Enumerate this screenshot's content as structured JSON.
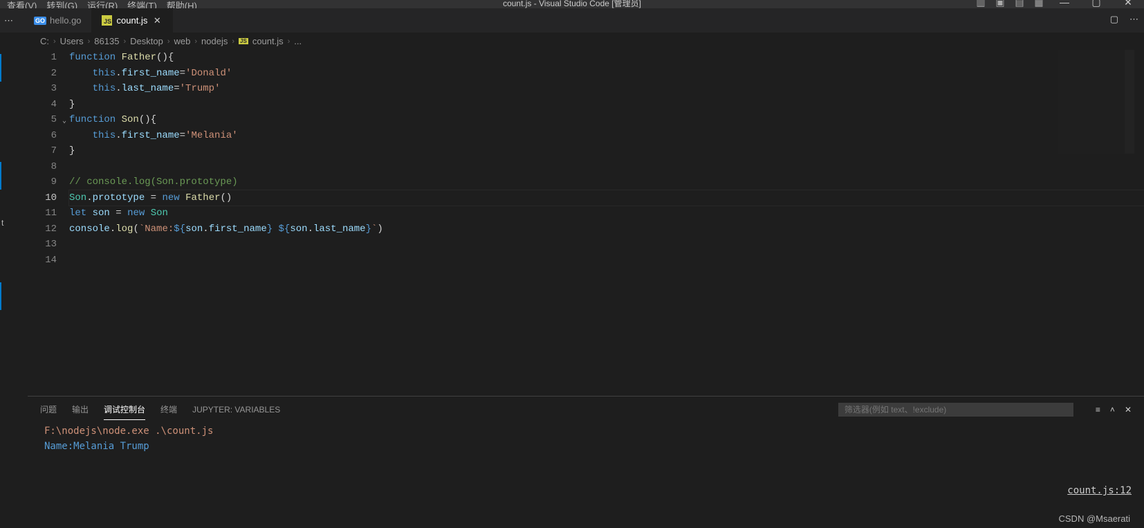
{
  "menubar": {
    "view": "查看(V)",
    "goto": "转到(G)",
    "run": "运行(R)",
    "terminal": "终端(T)",
    "help": "帮助(H)"
  },
  "window_title": "count.js - Visual Studio Code [管理员]",
  "tabs": [
    {
      "icon": "GO",
      "label": "hello.go",
      "active": false
    },
    {
      "icon": "JS",
      "label": "count.js",
      "active": true
    }
  ],
  "tab_overflow": "⋯",
  "editor_actions": {
    "split": "▢",
    "more": "⋯"
  },
  "breadcrumbs": [
    "C:",
    "Users",
    "86135",
    "Desktop",
    "web",
    "nodejs",
    "count.js",
    "..."
  ],
  "current_line": 10,
  "code": {
    "lines": [
      {
        "n": 1,
        "seg": [
          [
            "kw",
            "function"
          ],
          [
            "punc",
            " "
          ],
          [
            "fn",
            "Father"
          ],
          [
            "punc",
            "(){"
          ]
        ]
      },
      {
        "n": 2,
        "seg": [
          [
            "punc",
            "    "
          ],
          [
            "this",
            "this"
          ],
          [
            "punc",
            "."
          ],
          [
            "prop",
            "first_name"
          ],
          [
            "punc",
            "="
          ],
          [
            "str",
            "'Donald'"
          ]
        ]
      },
      {
        "n": 3,
        "seg": [
          [
            "punc",
            "    "
          ],
          [
            "this",
            "this"
          ],
          [
            "punc",
            "."
          ],
          [
            "prop",
            "last_name"
          ],
          [
            "punc",
            "="
          ],
          [
            "str",
            "'Trump'"
          ]
        ]
      },
      {
        "n": 4,
        "seg": [
          [
            "punc",
            "}"
          ]
        ]
      },
      {
        "n": 5,
        "fold": true,
        "seg": [
          [
            "kw",
            "function"
          ],
          [
            "punc",
            " "
          ],
          [
            "fn",
            "Son"
          ],
          [
            "punc",
            "(){"
          ]
        ]
      },
      {
        "n": 6,
        "seg": [
          [
            "punc",
            "    "
          ],
          [
            "this",
            "this"
          ],
          [
            "punc",
            "."
          ],
          [
            "prop",
            "first_name"
          ],
          [
            "punc",
            "="
          ],
          [
            "str",
            "'Melania'"
          ]
        ]
      },
      {
        "n": 7,
        "seg": [
          [
            "punc",
            "}"
          ]
        ]
      },
      {
        "n": 8,
        "seg": []
      },
      {
        "n": 9,
        "seg": [
          [
            "comment",
            "// console.log(Son.prototype)"
          ]
        ]
      },
      {
        "n": 10,
        "seg": [
          [
            "class",
            "Son"
          ],
          [
            "punc",
            "."
          ],
          [
            "prop",
            "prototype"
          ],
          [
            "punc",
            " = "
          ],
          [
            "kw",
            "new"
          ],
          [
            "punc",
            " "
          ],
          [
            "fn",
            "Father"
          ],
          [
            "punc",
            "()"
          ]
        ]
      },
      {
        "n": 11,
        "seg": [
          [
            "kw",
            "let"
          ],
          [
            "punc",
            " "
          ],
          [
            "var",
            "son"
          ],
          [
            "punc",
            " = "
          ],
          [
            "kw",
            "new"
          ],
          [
            "punc",
            " "
          ],
          [
            "class",
            "Son"
          ]
        ]
      },
      {
        "n": 12,
        "seg": [
          [
            "var",
            "console"
          ],
          [
            "punc",
            "."
          ],
          [
            "fn",
            "log"
          ],
          [
            "punc",
            "("
          ],
          [
            "tmpl",
            "`Name:"
          ],
          [
            "kw",
            "${"
          ],
          [
            "var",
            "son"
          ],
          [
            "punc",
            "."
          ],
          [
            "prop",
            "first_name"
          ],
          [
            "kw",
            "}"
          ],
          [
            "tmpl",
            " "
          ],
          [
            "kw",
            "${"
          ],
          [
            "var",
            "son"
          ],
          [
            "punc",
            "."
          ],
          [
            "prop",
            "last_name"
          ],
          [
            "kw",
            "}"
          ],
          [
            "tmpl",
            "`"
          ],
          [
            "punc",
            ")"
          ]
        ]
      },
      {
        "n": 13,
        "seg": []
      },
      {
        "n": 14,
        "seg": []
      }
    ]
  },
  "panel": {
    "tabs": {
      "problems": "问题",
      "output": "输出",
      "debug": "调试控制台",
      "terminal": "终端",
      "jupyter": "JUPYTER: VARIABLES"
    },
    "active_tab": "debug",
    "filter_placeholder": "筛选器(例如 text、!exclude)",
    "cmd": "F:\\nodejs\\node.exe .\\count.js",
    "stdout": "Name:Melania Trump",
    "stack_link": "count.js:12"
  },
  "left_hint": "t",
  "watermark": "CSDN @Msaerati"
}
